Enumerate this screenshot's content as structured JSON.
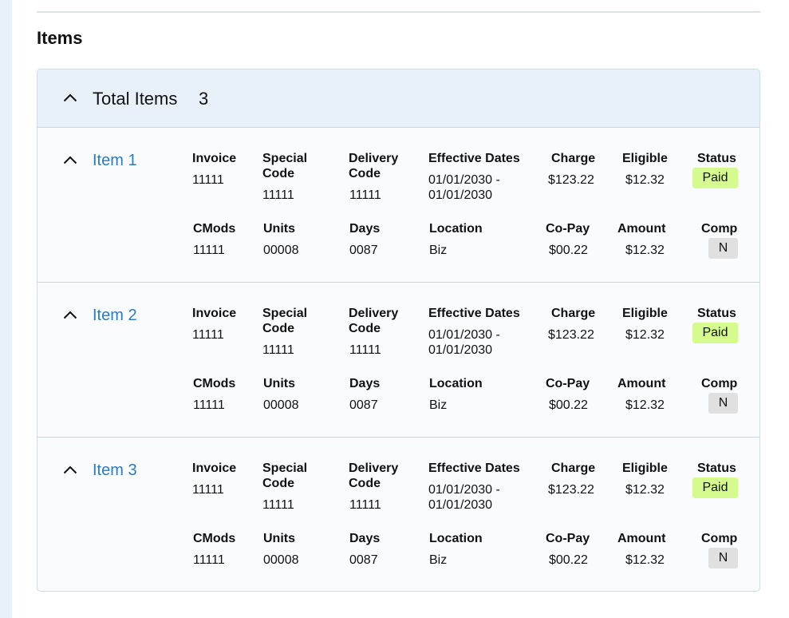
{
  "page": {
    "title": "Items"
  },
  "panel": {
    "title": "Total Items",
    "count": "3"
  },
  "labels": {
    "invoice": "Invoice",
    "special_code_1": "Special",
    "special_code_2": "Code",
    "delivery_code_1": "Delivery",
    "delivery_code_2": "Code",
    "effective_dates": "Effective Dates",
    "charge": "Charge",
    "eligible": "Eligible",
    "status": "Status",
    "cmods": "CMods",
    "units": "Units",
    "days": "Days",
    "location": "Location",
    "copay": "Co-Pay",
    "amount": "Amount",
    "comp": "Comp"
  },
  "items": [
    {
      "name": "Item 1",
      "invoice": "11111",
      "special_code": "11111",
      "delivery_code": "11111",
      "date_from": "01/01/2030 -",
      "date_to": "01/01/2030",
      "charge": "$123.22",
      "eligible": "$12.32",
      "status": "Paid",
      "cmods": "11111",
      "units": "00008",
      "days": "0087",
      "location": "Biz",
      "copay": "$00.22",
      "amount": "$12.32",
      "comp": "N"
    },
    {
      "name": "Item 2",
      "invoice": "11111",
      "special_code": "11111",
      "delivery_code": "11111",
      "date_from": "01/01/2030 -",
      "date_to": "01/01/2030",
      "charge": "$123.22",
      "eligible": "$12.32",
      "status": "Paid",
      "cmods": "11111",
      "units": "00008",
      "days": "0087",
      "location": "Biz",
      "copay": "$00.22",
      "amount": "$12.32",
      "comp": "N"
    },
    {
      "name": "Item 3",
      "invoice": "11111",
      "special_code": "11111",
      "delivery_code": "11111",
      "date_from": "01/01/2030 -",
      "date_to": "01/01/2030",
      "charge": "$123.22",
      "eligible": "$12.32",
      "status": "Paid",
      "cmods": "11111",
      "units": "00008",
      "days": "0087",
      "location": "Biz",
      "copay": "$00.22",
      "amount": "$12.32",
      "comp": "N"
    }
  ],
  "icons": {
    "collapse": "chevron-up-icon"
  },
  "colors": {
    "link": "#2b7bc0",
    "paid_badge": "#d5fa8e",
    "comp_badge": "#e0e0e0",
    "header_bg": "#e8f1fa"
  }
}
